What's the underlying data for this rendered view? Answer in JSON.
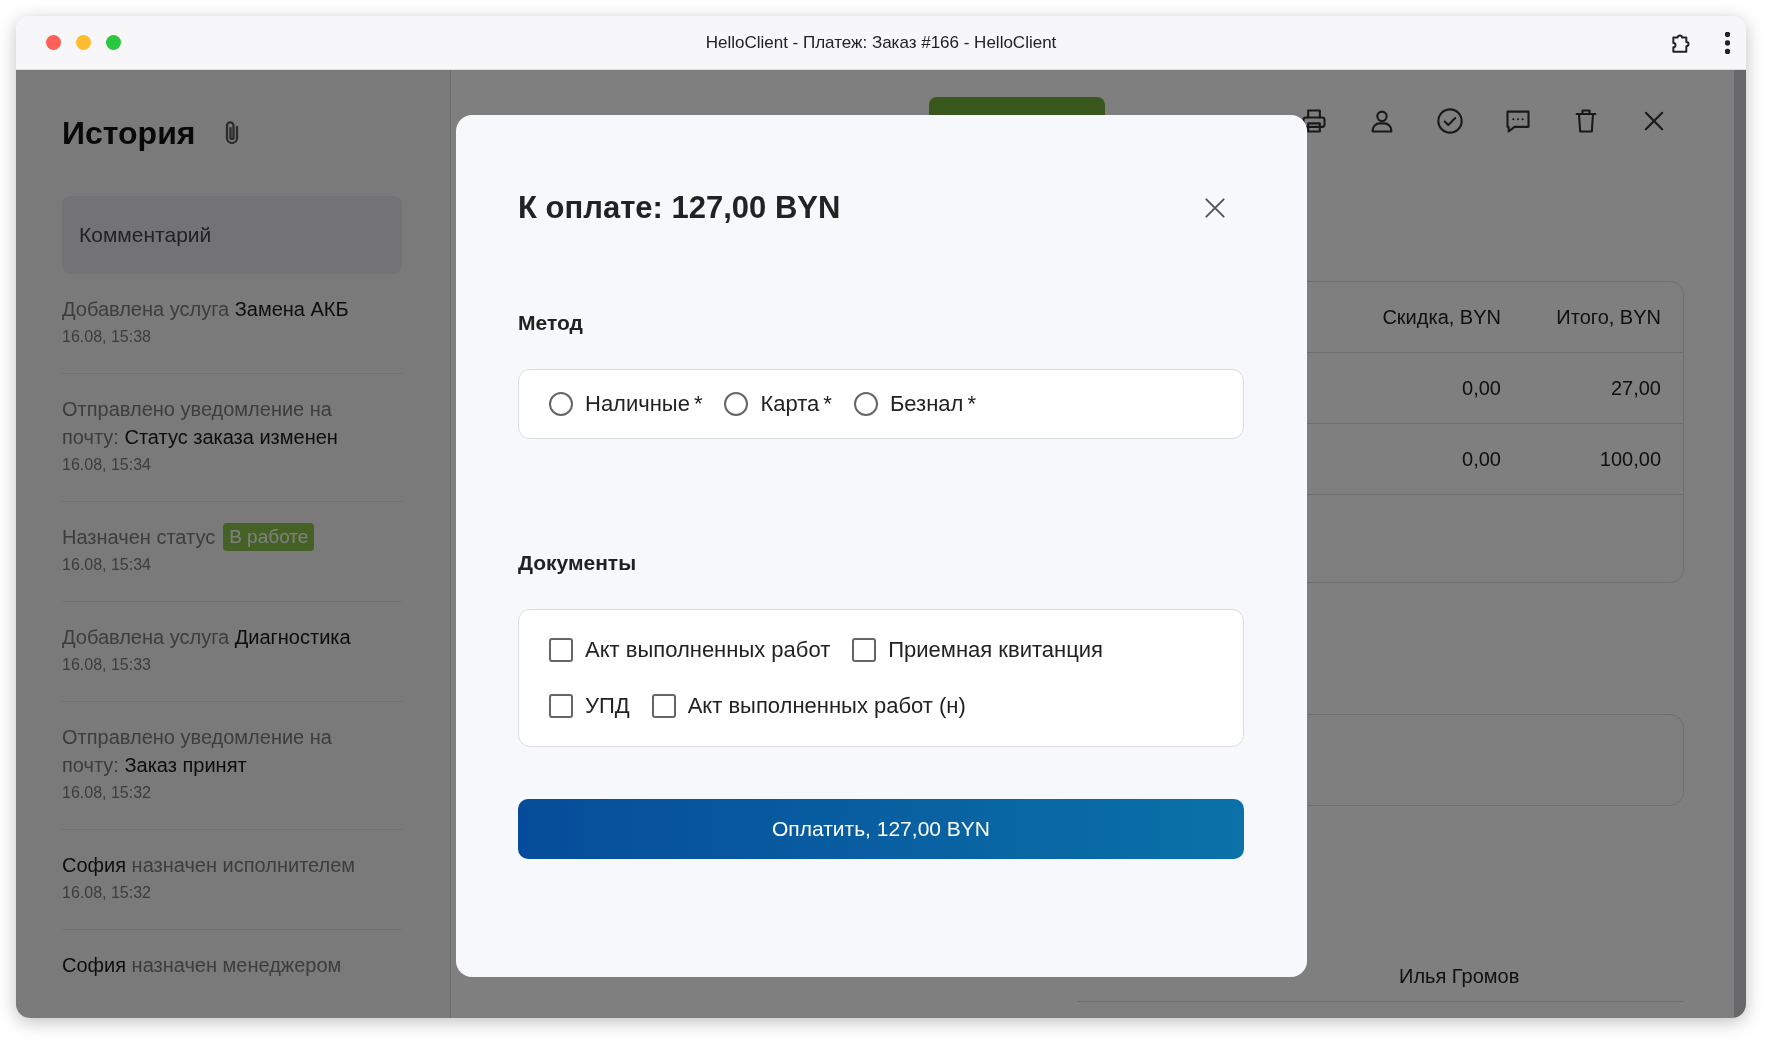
{
  "window": {
    "title": "HelloClient - Платеж: Заказ #166 - HelloClient"
  },
  "history": {
    "title": "История",
    "comment": {
      "placeholder": "Комментарий"
    },
    "items": [
      {
        "parts": [
          {
            "kind": "muted",
            "text": "Добавлена услуга "
          },
          {
            "kind": "strong",
            "text": "Замена АКБ"
          }
        ],
        "time": "16.08, 15:38"
      },
      {
        "parts": [
          {
            "kind": "muted",
            "text": "Отправлено уведомление на почту: "
          },
          {
            "kind": "strong",
            "text": "Статус заказа изменен"
          }
        ],
        "time": "16.08, 15:34"
      },
      {
        "parts": [
          {
            "kind": "muted",
            "text": "Назначен статус"
          }
        ],
        "badge": "В работе",
        "time": "16.08, 15:34"
      },
      {
        "parts": [
          {
            "kind": "muted",
            "text": "Добавлена услуга "
          },
          {
            "kind": "strong",
            "text": "Диагностика"
          }
        ],
        "time": "16.08, 15:33"
      },
      {
        "parts": [
          {
            "kind": "muted",
            "text": "Отправлено уведомление на почту: "
          },
          {
            "kind": "strong",
            "text": "Заказ принят"
          }
        ],
        "time": "16.08, 15:32"
      },
      {
        "parts": [
          {
            "kind": "strong",
            "text": "София"
          },
          {
            "kind": "muted",
            "text": " назначен исполнителем"
          }
        ],
        "time": "16.08, 15:32"
      },
      {
        "parts": [
          {
            "kind": "strong",
            "text": "София"
          },
          {
            "kind": "muted",
            "text": " назначен менеджером"
          }
        ]
      }
    ]
  },
  "order": {
    "table": {
      "columns": [
        "Скидка, BYN",
        "Итого, BYN"
      ],
      "rows": [
        [
          "0,00",
          "27,00"
        ],
        [
          "0,00",
          "100,00"
        ]
      ]
    },
    "details_row": {
      "value": "Илья Громов"
    }
  },
  "dialog": {
    "title": "К оплате: 127,00 BYN",
    "sections": [
      {
        "kind": "radio",
        "label": "Метод",
        "rows": [
          [
            {
              "label": "Наличные",
              "asterisk": "*",
              "selected": false
            },
            {
              "label": "Карта",
              "asterisk": "*",
              "selected": false
            },
            {
              "label": "Безнал",
              "asterisk": "*",
              "selected": false
            }
          ]
        ]
      },
      {
        "kind": "checkbox",
        "label": "Документы",
        "rows": [
          [
            {
              "label": "Акт выполненных работ",
              "checked": false
            },
            {
              "label": "Приемная квитанция",
              "checked": false
            }
          ],
          [
            {
              "label": "УПД",
              "checked": false
            },
            {
              "label": "Акт выполненных работ (н)",
              "checked": false
            }
          ]
        ]
      }
    ],
    "submit": "Оплатить, 127,00 BYN"
  }
}
